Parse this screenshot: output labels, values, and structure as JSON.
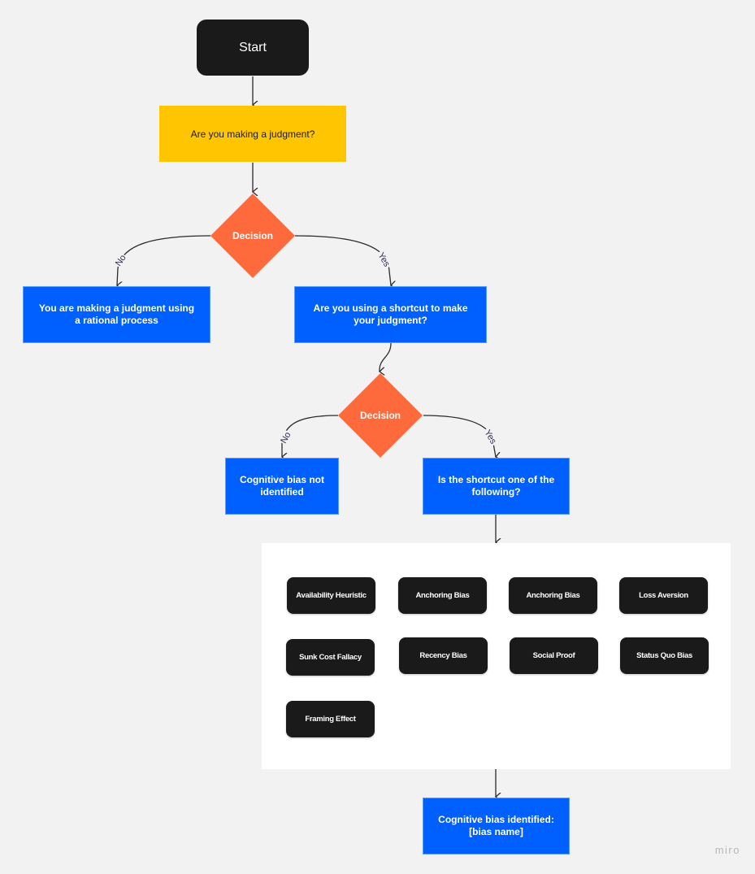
{
  "diagram": {
    "start": {
      "label": "Start"
    },
    "question1": {
      "label": "Are you making a judgment?"
    },
    "decision1": {
      "label": "Decision",
      "no_label": "No",
      "yes_label": "Yes"
    },
    "rational_process": {
      "label": "You are making a judgment using a rational process"
    },
    "shortcut_question": {
      "label": "Are you using a shortcut to make your judgment?"
    },
    "decision2": {
      "label": "Decision",
      "no_label": "No",
      "yes_label": "Yes"
    },
    "bias_not_identified": {
      "label": "Cognitive bias not identified"
    },
    "shortcut_list_question": {
      "label": "Is the shortcut one of the following?"
    },
    "biases": [
      "Availability Heuristic",
      "Anchoring Bias",
      "Anchoring Bias",
      "Loss Aversion",
      "Sunk Cost Fallacy",
      "Recency Bias",
      "Social Proof",
      "Status Quo Bias",
      "Framing Effect"
    ],
    "bias_identified": {
      "label": "Cognitive bias identified: [bias name]"
    }
  },
  "colors": {
    "canvas": "#f2f2f2",
    "terminal": "#1a1a1a",
    "question": "#ffc600",
    "process": "#0060ff",
    "decision": "#ff6a3d",
    "connector": "#2b2b2b"
  },
  "watermark": "miro"
}
